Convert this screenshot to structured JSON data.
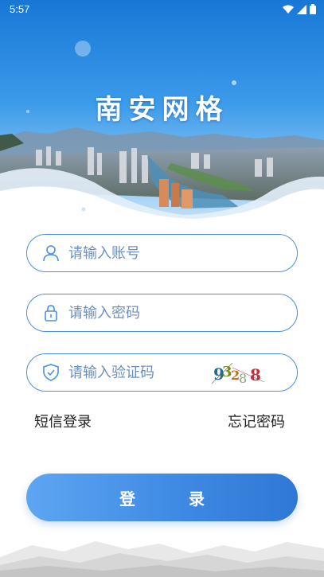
{
  "status_bar": {
    "time": "5:57",
    "icons": [
      "wifi-icon",
      "signal-icon",
      "battery-icon"
    ]
  },
  "app": {
    "title": "南安网格"
  },
  "form": {
    "account_placeholder": "请输入账号",
    "password_placeholder": "请输入密码",
    "captcha_placeholder": "请输入验证码",
    "captcha_image_text": "93288"
  },
  "links": {
    "sms_login": "短信登录",
    "forgot_password": "忘记密码"
  },
  "login_button": "登 录",
  "colors": {
    "accent": "#4a90e2",
    "button_start": "#5ea6f2",
    "button_end": "#2f78d6",
    "sky": "#2a8ae0",
    "placeholder": "#6d8fbf"
  }
}
